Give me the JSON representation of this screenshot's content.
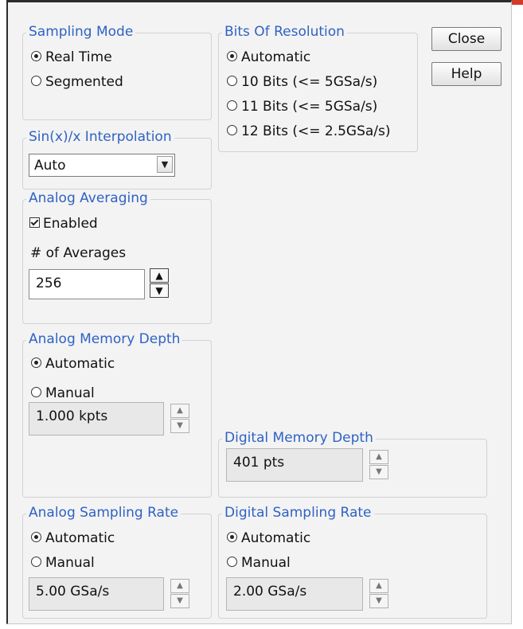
{
  "buttons": {
    "close": "Close",
    "help": "Help"
  },
  "sampling_mode": {
    "title": "Sampling Mode",
    "options": [
      {
        "label": "Real Time",
        "selected": true
      },
      {
        "label": "Segmented",
        "selected": false
      }
    ]
  },
  "bits_of_resolution": {
    "title": "Bits Of Resolution",
    "options": [
      {
        "label": "Automatic",
        "selected": true
      },
      {
        "label": "10 Bits (<= 5GSa/s)",
        "selected": false
      },
      {
        "label": "11 Bits (<= 5GSa/s)",
        "selected": false
      },
      {
        "label": "12 Bits (<= 2.5GSa/s)",
        "selected": false
      }
    ]
  },
  "interpolation": {
    "title": "Sin(x)/x Interpolation",
    "value": "Auto"
  },
  "analog_averaging": {
    "title": "Analog Averaging",
    "enabled_label": "Enabled",
    "enabled": true,
    "averages_label": "# of Averages",
    "averages_value": "256"
  },
  "analog_memory_depth": {
    "title": "Analog Memory Depth",
    "automatic_label": "Automatic",
    "manual_label": "Manual",
    "selected": "automatic",
    "value": "1.000 kpts"
  },
  "digital_memory_depth": {
    "title": "Digital Memory Depth",
    "value": "401 pts"
  },
  "analog_sampling_rate": {
    "title": "Analog Sampling Rate",
    "automatic_label": "Automatic",
    "manual_label": "Manual",
    "selected": "automatic",
    "value": "5.00 GSa/s"
  },
  "digital_sampling_rate": {
    "title": "Digital Sampling Rate",
    "automatic_label": "Automatic",
    "manual_label": "Manual",
    "selected": "automatic",
    "value": "2.00 GSa/s"
  }
}
